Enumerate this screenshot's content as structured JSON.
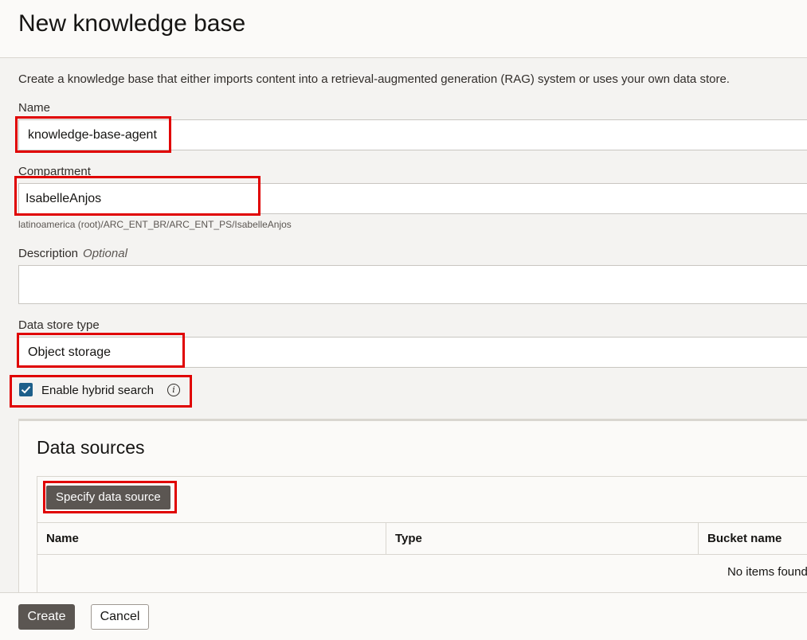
{
  "page": {
    "title": "New knowledge base",
    "intro": "Create a knowledge base that either imports content into a retrieval-augmented generation (RAG) system or uses your own data store."
  },
  "form": {
    "name_label": "Name",
    "name_value": "knowledge-base-agent",
    "compartment_label": "Compartment",
    "compartment_value": "IsabelleAnjos",
    "compartment_path": "latinoamerica (root)/ARC_ENT_BR/ARC_ENT_PS/IsabelleAnjos",
    "description_label": "Description",
    "description_optional": "Optional",
    "description_value": "",
    "data_store_type_label": "Data store type",
    "data_store_type_value": "Object storage",
    "hybrid_search_label": "Enable hybrid search",
    "hybrid_search_checked": true
  },
  "data_sources": {
    "title": "Data sources",
    "specify_button": "Specify data source",
    "columns": [
      "Name",
      "Type",
      "Bucket name"
    ],
    "empty_text": "No items found."
  },
  "footer": {
    "create": "Create",
    "cancel": "Cancel"
  },
  "colors": {
    "highlight": "#e00000",
    "checkbox": "#1d5f8a",
    "primary_button": "#5b5652"
  },
  "icons": {
    "info": "info-icon",
    "check": "checkmark-icon"
  }
}
